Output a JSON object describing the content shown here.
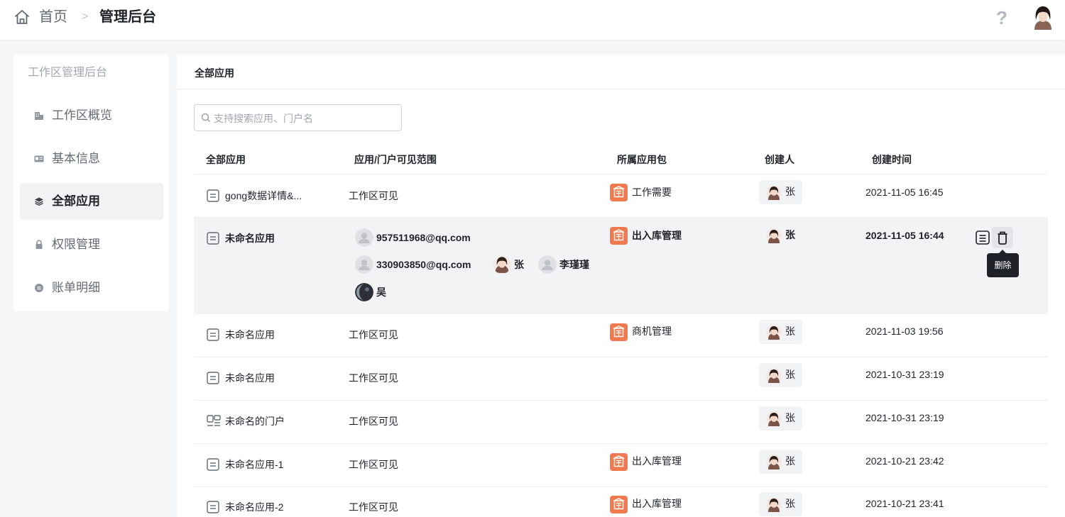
{
  "header": {
    "breadcrumb_home": "首页",
    "breadcrumb_separator": ">",
    "breadcrumb_current": "管理后台",
    "help_symbol": "?"
  },
  "sidebar": {
    "title": "工作区管理后台",
    "items": [
      {
        "label": "工作区概览",
        "icon": "building-icon",
        "active": false
      },
      {
        "label": "基本信息",
        "icon": "id-card-icon",
        "active": false
      },
      {
        "label": "全部应用",
        "icon": "layers-icon",
        "active": true
      },
      {
        "label": "权限管理",
        "icon": "lock-icon",
        "active": false
      },
      {
        "label": "账单明细",
        "icon": "coin-icon",
        "active": false
      }
    ]
  },
  "main": {
    "title": "全部应用",
    "search_placeholder": "支持搜索应用、门户名",
    "columns": [
      "全部应用",
      "应用/门户可见范围",
      "所属应用包",
      "创建人",
      "创建时间"
    ],
    "rows": [
      {
        "name": "gong数据详情&...",
        "type": "app",
        "scope": "工作区可见",
        "package": "工作需要",
        "creator": "张",
        "time": "2021-11-05 16:45"
      },
      {
        "name": "未命名应用",
        "type": "app",
        "scope": "",
        "package": "出入库管理",
        "creator": "张",
        "time": "2021-11-05 16:44",
        "members": [
          {
            "name": "957511968@qq.com",
            "avatar": "default"
          },
          {
            "name": "330903850@qq.com",
            "avatar": "default"
          },
          {
            "name": "张",
            "avatar": "photo"
          },
          {
            "name": "李瑾瑾",
            "avatar": "default"
          },
          {
            "name": "吴",
            "avatar": "dark"
          }
        ]
      },
      {
        "name": "未命名应用",
        "type": "app",
        "scope": "工作区可见",
        "package": "商机管理",
        "creator": "张",
        "time": "2021-11-03 19:56"
      },
      {
        "name": "未命名应用",
        "type": "app",
        "scope": "工作区可见",
        "package": "",
        "creator": "张",
        "time": "2021-10-31 23:19"
      },
      {
        "name": "未命名的门户",
        "type": "portal",
        "scope": "工作区可见",
        "package": "",
        "creator": "张",
        "time": "2021-10-31 23:19"
      },
      {
        "name": "未命名应用-1",
        "type": "app",
        "scope": "工作区可见",
        "package": "出入库管理",
        "creator": "张",
        "time": "2021-10-21 23:42"
      },
      {
        "name": "未命名应用-2",
        "type": "app",
        "scope": "工作区可见",
        "package": "出入库管理",
        "creator": "张",
        "time": "2021-10-21 23:41"
      }
    ],
    "tooltip": "删除"
  },
  "colors": {
    "accent_package": "#f07950",
    "hover_row": "#f2f3f5",
    "tooltip_bg": "#1f2329"
  }
}
